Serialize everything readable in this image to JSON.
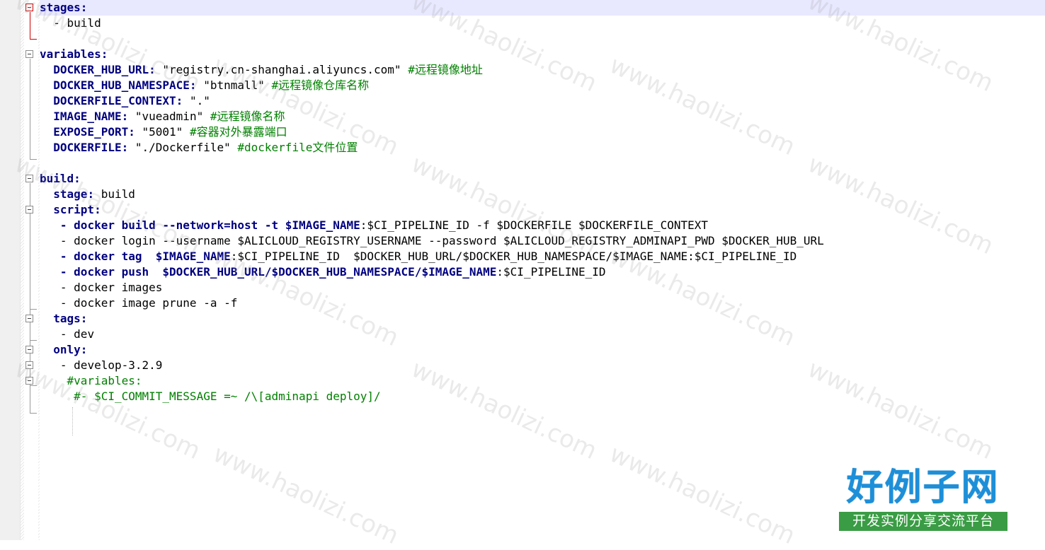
{
  "code": {
    "l1_key": "stages",
    "l2_text": "  - build",
    "l4_key": "variables",
    "l5_key": "DOCKER_HUB_URL",
    "l5_val": "\"registry.cn-shanghai.aliyuncs.com\"",
    "l5_cm": "#远程镜像地址",
    "l6_key": "DOCKER_HUB_NAMESPACE",
    "l6_val": "\"btnmall\"",
    "l6_cm": "#远程镜像仓库名称",
    "l7_key": "DOCKERFILE_CONTEXT",
    "l7_val": "\".\"",
    "l8_key": "IMAGE_NAME",
    "l8_val": "\"vueadmin\"",
    "l8_cm": "#远程镜像名称",
    "l9_key": "EXPOSE_PORT",
    "l9_val": "\"5001\"",
    "l9_cm": "#容器对外暴露端口",
    "l10_key": "DOCKERFILE",
    "l10_val": "\"./Dockerfile\"",
    "l10_cm": "#dockerfile文件位置",
    "l12_key": "build",
    "l13_key": "stage",
    "l13_val": "build",
    "l14_key": "script",
    "l15_kw": "- docker build --network=host -t $IMAGE_NAME",
    "l15_rest": ":$CI_PIPELINE_ID -f $DOCKERFILE $DOCKERFILE_CONTEXT",
    "l16_text": "- docker login --username $ALICLOUD_REGISTRY_USERNAME --password $ALICLOUD_REGISTRY_ADMINAPI_PWD $DOCKER_HUB_URL",
    "l17_kw": "- docker tag  $IMAGE_NAME",
    "l17_rest": ":$CI_PIPELINE_ID  $DOCKER_HUB_URL/$DOCKER_HUB_NAMESPACE/$IMAGE_NAME:$CI_PIPELINE_ID",
    "l18_kw": "- docker push  $DOCKER_HUB_URL/$DOCKER_HUB_NAMESPACE/$IMAGE_NAME",
    "l18_rest": ":$CI_PIPELINE_ID",
    "l19_text": "- docker images",
    "l20_text": "- docker image prune -a -f",
    "l21_key": "tags",
    "l22_text": "- dev",
    "l23_key": "only",
    "l24_text": "- develop-3.2.9",
    "l25_cm": "#variables:",
    "l26_cm": "#- $CI_COMMIT_MESSAGE =~ /\\[adminapi deploy]/"
  },
  "colon": ":",
  "watermark": {
    "text": "www.haolizi.com"
  },
  "logo": {
    "title": "好例子网",
    "subtitle": "开发实例分享交流平台"
  }
}
